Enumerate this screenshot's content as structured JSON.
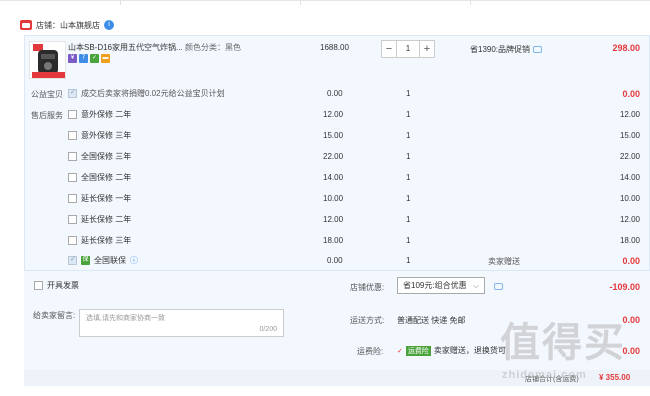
{
  "shop": {
    "label": "店铺：山本旗舰店"
  },
  "item": {
    "title": "山本SB-D16家用五代空气炸锅...",
    "color": "颜色分类：黑色",
    "unit_price": "1688.00",
    "quantity": "1",
    "promo": "省1390:品牌促销",
    "total": "298.00"
  },
  "public_good": {
    "label": "公益宝贝",
    "text": "成交后卖家将捐赠0.02元给公益宝贝计划",
    "price": "0.00",
    "qty": "1",
    "total": "0.00"
  },
  "after_sales": {
    "label": "售后服务",
    "options": [
      {
        "name": "意外保修 二年",
        "price": "12.00",
        "qty": "1",
        "total": "12.00"
      },
      {
        "name": "意外保修 三年",
        "price": "15.00",
        "qty": "1",
        "total": "15.00"
      },
      {
        "name": "全国保修 三年",
        "price": "22.00",
        "qty": "1",
        "total": "22.00"
      },
      {
        "name": "全国保修 二年",
        "price": "14.00",
        "qty": "1",
        "total": "14.00"
      },
      {
        "name": "延长保修 一年",
        "price": "10.00",
        "qty": "1",
        "total": "10.00"
      },
      {
        "name": "延长保修 二年",
        "price": "12.00",
        "qty": "1",
        "total": "12.00"
      },
      {
        "name": "延长保修 三年",
        "price": "18.00",
        "qty": "1",
        "total": "18.00"
      }
    ],
    "joint": {
      "name": "全国联保",
      "price": "0.00",
      "qty": "1",
      "gift": "卖家赠送",
      "total": "0.00"
    }
  },
  "invoice": {
    "label": "开具发票"
  },
  "shop_discount": {
    "label": "店铺优惠:",
    "selected": "省109元:组合优惠",
    "amount": "-109.00"
  },
  "remark": {
    "label": "给卖家留言:",
    "placeholder": "选填,请先和商家协商一致",
    "count": "0/200"
  },
  "delivery": {
    "label": "运送方式:",
    "value": "普通配送 快递 免邮",
    "amount": "0.00"
  },
  "shipping_insurance": {
    "label": "运费险:",
    "tag": "运费险",
    "text": "卖家赠送，退换货可",
    "amount": "0.00"
  },
  "footer": {
    "text": "店铺合计(含运费)",
    "total": "¥ 355.00"
  },
  "watermark": {
    "text": "值得买",
    "sub": "zhidemai.com"
  },
  "colors": {
    "accent_red": "#e4393c",
    "panel_bg": "#f3f8fe",
    "link_blue": "#3d8de8",
    "green_tag": "#4aa33b"
  }
}
